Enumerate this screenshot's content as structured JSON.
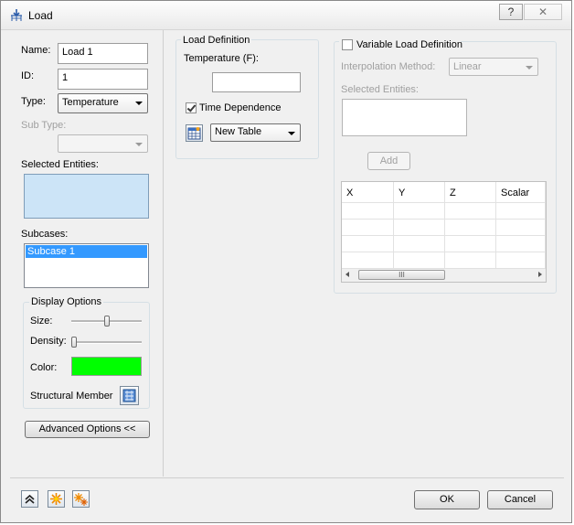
{
  "window": {
    "title": "Load",
    "help_label": "?",
    "close_label": "✕"
  },
  "left": {
    "name_label": "Name:",
    "name_value": "Load 1",
    "id_label": "ID:",
    "id_value": "1",
    "type_label": "Type:",
    "type_value": "Temperature",
    "subtype_label": "Sub Type:",
    "subtype_value": "",
    "selected_entities_label": "Selected Entities:",
    "subcases_label": "Subcases:",
    "subcases": [
      "Subcase 1"
    ],
    "display_options": {
      "title": "Display Options",
      "size_label": "Size:",
      "size_level": 0.5,
      "density_label": "Density:",
      "density_level": 0.0,
      "color_label": "Color:",
      "color_value": "#00ff00",
      "structural_member_label": "Structural Member"
    },
    "advanced_label": "Advanced Options <<"
  },
  "load_definition": {
    "title": "Load Definition",
    "temperature_label": "Temperature (F):",
    "temperature_value": "",
    "time_dependence_label": "Time Dependence",
    "time_dependence_checked": true,
    "table_value": "New Table"
  },
  "variable": {
    "label": "Variable Load Definition",
    "checked": false,
    "interp_label": "Interpolation Method:",
    "interp_value": "Linear",
    "selected_entities_label": "Selected Entities:",
    "add_label": "Add",
    "columns": [
      "X",
      "Y",
      "Z",
      "Scalar"
    ],
    "scroll_grip": "III"
  },
  "footer": {
    "ok_label": "OK",
    "cancel_label": "Cancel"
  },
  "colors": {
    "accent": "#3399ff",
    "selected_entities_bg": "#cce4f7",
    "color_swatch": "#00ff00"
  }
}
